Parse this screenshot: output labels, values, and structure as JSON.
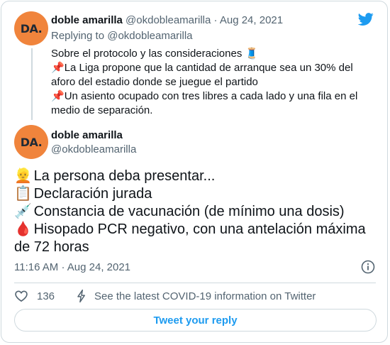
{
  "parent_tweet": {
    "avatar_text": "DA.",
    "name": "doble amarilla",
    "handle": "@okdobleamarilla",
    "separator": "·",
    "date": "Aug 24, 2021",
    "replying_prefix": "Replying to",
    "replying_to": "@okdobleamarilla",
    "lines": [
      {
        "text": "Sobre el protocolo y las consideraciones",
        "emoji_after": "🧵"
      },
      {
        "emoji": "📌",
        "text": "La Liga propone que la cantidad de arranque sea un 30% del aforo del estadio donde se juegue el partido"
      },
      {
        "emoji": "📌",
        "text": "Un asiento ocupado con tres libres a cada lado y una fila en el medio de separación."
      }
    ]
  },
  "main_tweet": {
    "avatar_text": "DA.",
    "name": "doble amarilla",
    "handle": "@okdobleamarilla",
    "lines": [
      {
        "emoji": "👱",
        "text": "La persona deba presentar..."
      },
      {
        "emoji": "📋",
        "text": "Declaración jurada"
      },
      {
        "emoji": "💉",
        "text": "Constancia de vacunación (de mínimo una dosis)"
      },
      {
        "emoji": "🩸",
        "text": "Hisopado PCR negativo, con una antelación máxima de 72 horas"
      }
    ],
    "time": "11:16 AM",
    "separator": "·",
    "date": "Aug 24, 2021"
  },
  "actions": {
    "likes": "136",
    "covid_info": "See the latest COVID-19 information on Twitter"
  },
  "reply_button": "Tweet your reply",
  "colors": {
    "accent": "#1d9bf0",
    "avatar": "#f0843c",
    "muted": "#536471",
    "border": "#cfd9de"
  },
  "icons": [
    "twitter-bird-icon",
    "info-icon",
    "heart-icon",
    "covid-bolt-icon"
  ]
}
